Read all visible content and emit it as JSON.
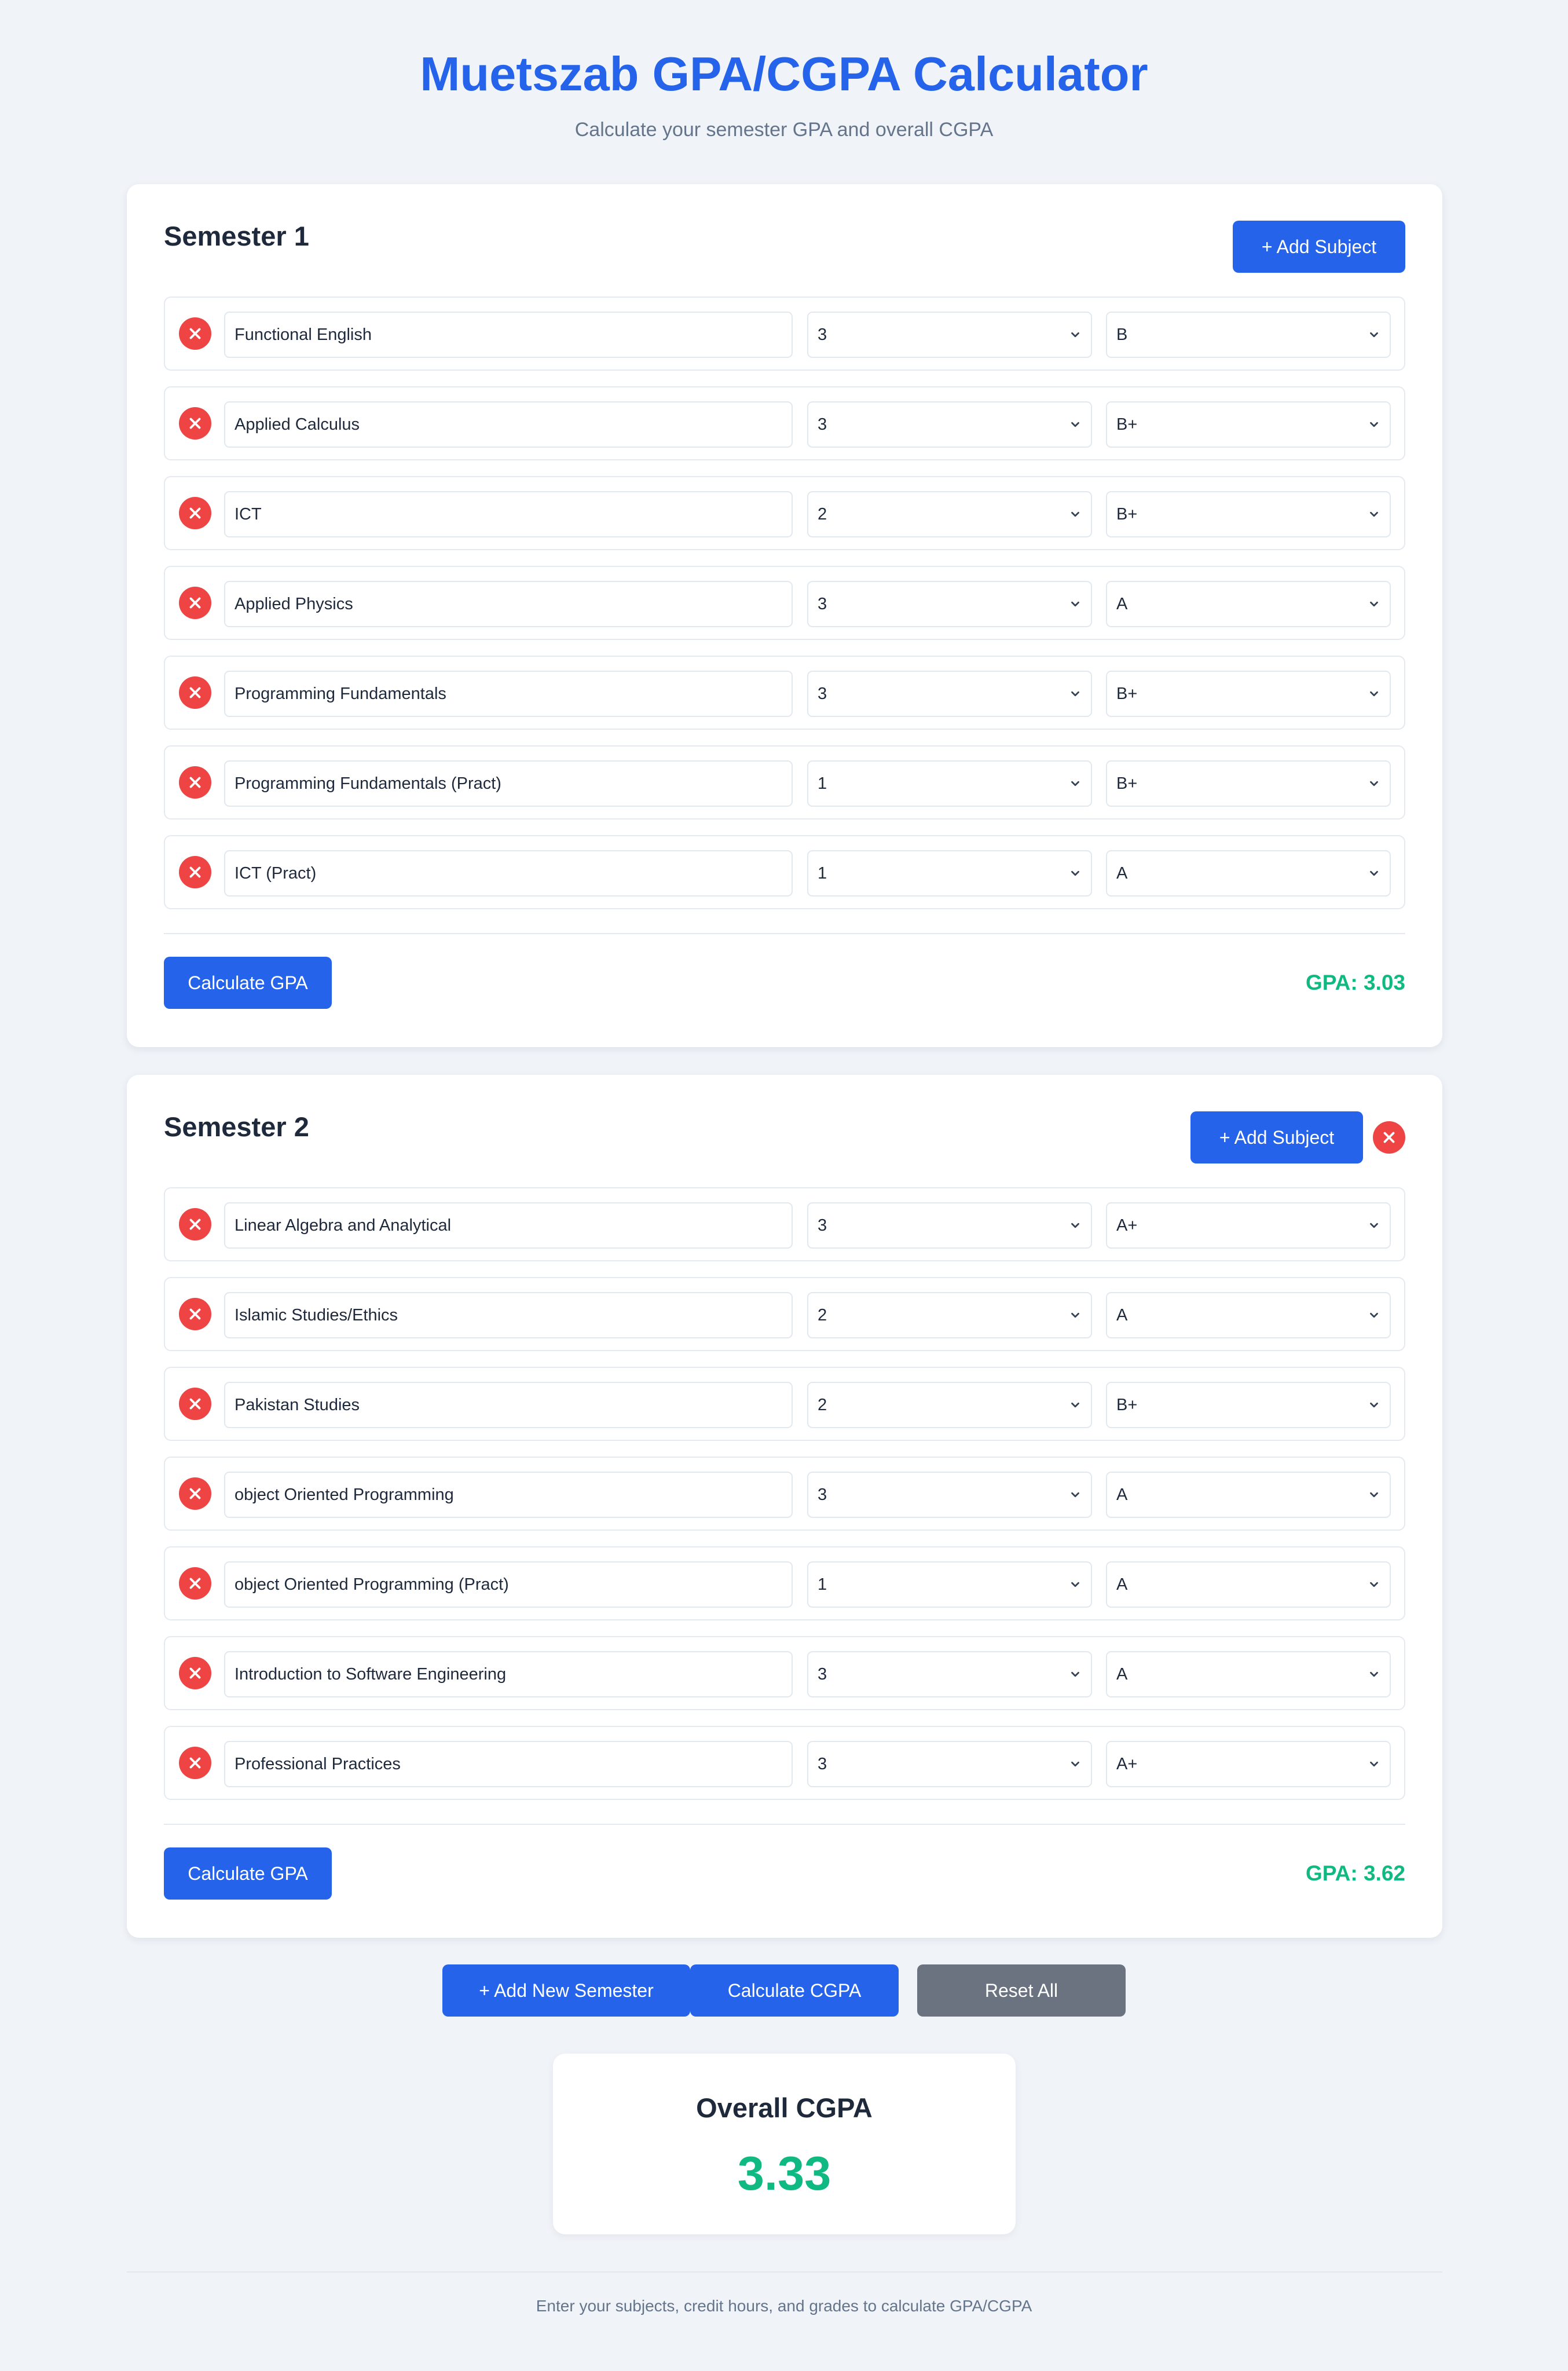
{
  "header": {
    "title": "Muetszab GPA/CGPA Calculator",
    "subtitle": "Calculate your semester GPA and overall CGPA"
  },
  "semesters": [
    {
      "title": "Semester 1",
      "add_subject_label": "+ Add Subject",
      "subjects": [
        {
          "name": "Functional English",
          "credits": "3",
          "grade": "B"
        },
        {
          "name": "Applied Calculus",
          "credits": "3",
          "grade": "B+"
        },
        {
          "name": "ICT",
          "credits": "2",
          "grade": "B+"
        },
        {
          "name": "Applied Physics",
          "credits": "3",
          "grade": "A"
        },
        {
          "name": "Programming Fundamentals",
          "credits": "3",
          "grade": "B+"
        },
        {
          "name": "Programming Fundamentals (Pract)",
          "credits": "1",
          "grade": "B+"
        },
        {
          "name": "ICT (Pract)",
          "credits": "1",
          "grade": "A"
        }
      ],
      "calculate_label": "Calculate GPA",
      "gpa_text": "GPA: 3.03"
    },
    {
      "title": "Semester 2",
      "add_subject_label": "+ Add Subject",
      "subjects": [
        {
          "name": "Linear Algebra and Analytical",
          "credits": "3",
          "grade": "A+"
        },
        {
          "name": "Islamic Studies/Ethics",
          "credits": "2",
          "grade": "A"
        },
        {
          "name": "Pakistan Studies",
          "credits": "2",
          "grade": "B+"
        },
        {
          "name": "object Oriented Programming",
          "credits": "3",
          "grade": "A"
        },
        {
          "name": "object Oriented Programming (Pract)",
          "credits": "1",
          "grade": "A"
        },
        {
          "name": "Introduction to Software Engineering",
          "credits": "3",
          "grade": "A"
        },
        {
          "name": "Professional Practices",
          "credits": "3",
          "grade": "A+"
        }
      ],
      "calculate_label": "Calculate GPA",
      "gpa_text": "GPA: 3.62"
    }
  ],
  "actions": {
    "add_semester_label": "+ Add New Semester",
    "calculate_cgpa_label": "Calculate CGPA",
    "reset_label": "Reset All"
  },
  "cgpa": {
    "title": "Overall CGPA",
    "value": "3.33"
  },
  "footer": {
    "text": "Enter your subjects, credit hours, and grades to calculate GPA/CGPA"
  },
  "colors": {
    "primary": "#2563eb",
    "success": "#10b981",
    "danger": "#ef4444",
    "neutral": "#6b7280",
    "background": "#f0f4f9"
  },
  "icons": {
    "remove": "close-icon",
    "dropdown": "chevron-down-icon"
  }
}
